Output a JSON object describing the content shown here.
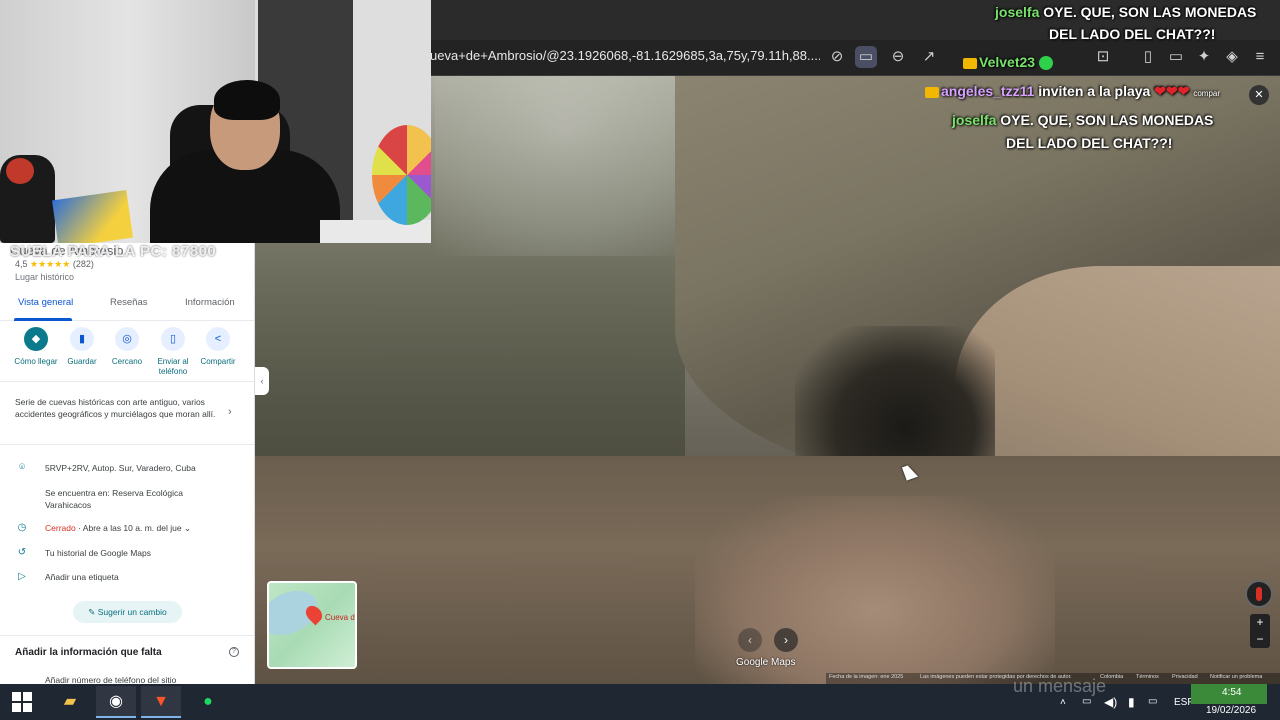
{
  "browser": {
    "url": "ueva+de+Ambrosio/@23.1926068,-81.1629685,3a,75y,79.11h,88...."
  },
  "stream_overlay": {
    "goal_text": "SUELA PARA LA PC: 87800",
    "chat": [
      {
        "user": "joselfa",
        "message": "OYE. QUE, SON LAS MONEDAS",
        "message2": "DEL LADO DEL CHAT??!"
      },
      {
        "user": "Velvet23",
        "message": ""
      },
      {
        "user": "angeles_tzz11",
        "message": "inviten a la playa",
        "hearts": "❤❤❤",
        "extra": "compar"
      },
      {
        "user": "joselfa",
        "message": "OYE. QUE, SON LAS MONEDAS",
        "message2": "DEL LADO DEL CHAT??!"
      }
    ]
  },
  "place": {
    "title": "Cueva de Ambrosio",
    "rating": "4,5",
    "stars": "★★★★★",
    "reviews": "(282)",
    "category": "Lugar histórico",
    "tabs": [
      "Vista general",
      "Reseñas",
      "Información"
    ],
    "actions": [
      {
        "label": "Cómo llegar",
        "icon": "directions-icon",
        "glyph": "◆"
      },
      {
        "label": "Guardar",
        "icon": "bookmark-icon",
        "glyph": "▮"
      },
      {
        "label": "Cercano",
        "icon": "nearby-icon",
        "glyph": "◎"
      },
      {
        "label": "Enviar al teléfono",
        "icon": "phone-icon",
        "glyph": "▯"
      },
      {
        "label": "Compartir",
        "icon": "share-icon",
        "glyph": "<"
      }
    ],
    "description": "Serie de cuevas históricas con arte antiguo, varios accidentes geográficos y murciélagos que moran allí.",
    "address": "5RVP+2RV, Autop. Sur, Varadero, Cuba",
    "located_in": "Se encuentra en: Reserva Ecológica Varahicacos",
    "hours_status": "Cerrado",
    "hours_detail": " · Abre a las 10 a. m. del jue",
    "history": "Tu historial de Google Maps",
    "label": "Añadir una etiqueta",
    "suggest": "Sugerir un cambio",
    "missing_title": "Añadir la información que falta",
    "add_phone": "Añadir número de teléfono del sitio"
  },
  "map": {
    "minimap_label": "Cueva de",
    "logo": "Google Maps",
    "footer": [
      "Fecha de la imagen: ene 2025",
      "Las imágenes pueden estar protegidas por derechos de autor.",
      "Colombia",
      "Términos",
      "Privacidad",
      "Notificar un problema"
    ],
    "watermark": "un mensaje"
  },
  "taskbar": {
    "language": "ESP",
    "time": "4:54",
    "date": "19/02/2026"
  }
}
